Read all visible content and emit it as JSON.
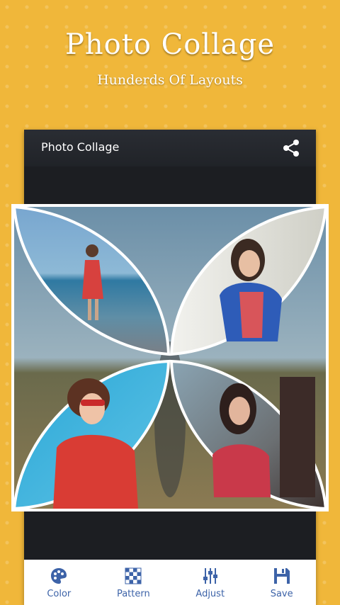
{
  "hero": {
    "title": "Photo Collage",
    "subtitle": "Hunderds Of Layouts"
  },
  "app_bar": {
    "title": "Photo Collage",
    "share_icon": "share-icon"
  },
  "toolbar": {
    "items": [
      {
        "label": "Color",
        "icon": "palette-icon"
      },
      {
        "label": "Pattern",
        "icon": "pattern-icon"
      },
      {
        "label": "Adjust",
        "icon": "sliders-icon"
      },
      {
        "label": "Save",
        "icon": "save-icon"
      }
    ]
  },
  "colors": {
    "accent": "#f0b73a",
    "toolbar_text": "#3d63a8",
    "app_bar": "#23262b"
  }
}
